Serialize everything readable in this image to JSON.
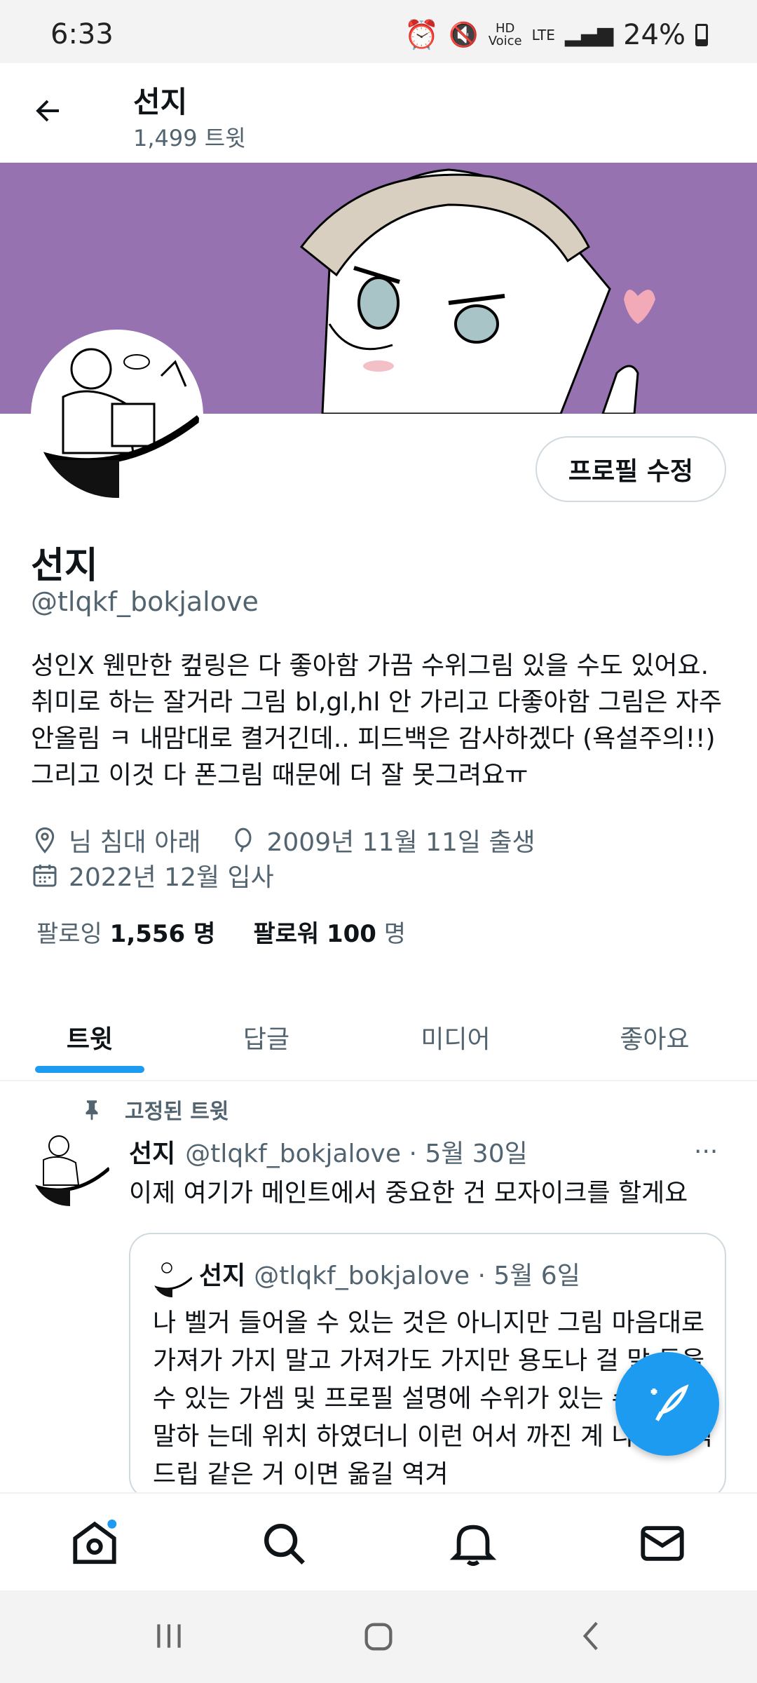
{
  "status_bar": {
    "time": "6:33",
    "battery": "24%",
    "network": "LTE",
    "hd_label": "HD",
    "voice_label": "Voice"
  },
  "header": {
    "title": "선지",
    "subtitle": "1,499 트윗"
  },
  "profile": {
    "edit_button": "프로필 수정",
    "name": "선지",
    "handle": "@tlqkf_bokjalove",
    "bio": "성인X 웬만한 컾링은 다 좋아함 가끔 수위그림 있을 수도 있어요. 취미로 하는 잘거라 그림 bl,gl,hl 안 가리고 다좋아함 그림은 자주 안올림 ㅋ 내맘대로 켤거긴데.. 피드백은 감사하겠다 (욕설주의!!) 그리고 이것 다 폰그림 때문에 더 잘 못그려요ㅠ",
    "location": "님 침대 아래",
    "birthday": "2009년 11월 11일 출생",
    "joined": "2022년 12월 입사",
    "following_label": "팔로잉",
    "following_count": "1,556 명",
    "followers_label": "팔로워",
    "followers_count": "100",
    "followers_unit": "명"
  },
  "tabs": [
    {
      "label": "트윗",
      "active": true
    },
    {
      "label": "답글",
      "active": false
    },
    {
      "label": "미디어",
      "active": false
    },
    {
      "label": "좋아요",
      "active": false
    }
  ],
  "pinned_tweet": {
    "pinned_label": "고정된 트윗",
    "name": "선지",
    "handle": "@tlqkf_bokjalove · 5월 30일",
    "more": "···",
    "text": "이제 여기가 메인트에서 중요한 건 모자이크를 할게요",
    "quote": {
      "name": "선지",
      "handle": "@tlqkf_bokjalove · 5월 6일",
      "text": "나 벨거 들어올 수 있는 것은 아니지만 그림 마음대로 가져가 가지 말고 가져가도 가지만 용도나 걸 말 들을 수 있는 가셈 및 프로필 설명에 수위가 있는 수도라고 말하 는데 위치 하였더니 이런 어서 까진 계 나한테 섹드립 같은 거 이면 옮길 역겨"
    }
  },
  "colors": {
    "accent": "#1d9bf0",
    "banner": "#9672b0",
    "secondary_text": "#536471"
  },
  "icons": [
    "back-arrow-icon",
    "location-pin-icon",
    "balloon-icon",
    "calendar-icon",
    "pin-icon",
    "more-icon",
    "compose-feather-icon",
    "home-icon",
    "search-icon",
    "bell-icon",
    "mail-icon"
  ]
}
